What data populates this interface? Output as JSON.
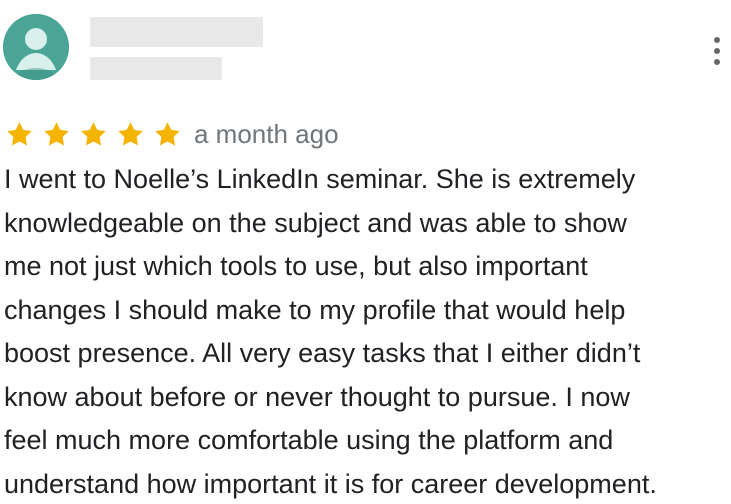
{
  "review": {
    "avatar_icon": "default-profile-avatar",
    "avatar_color": "#4aa597",
    "reviewer_name_redacted": true,
    "reviewer_meta_redacted": true,
    "more_icon": "more-vert-icon",
    "rating": 5,
    "max_rating": 5,
    "star_color": "#f4b400",
    "date": "a month ago",
    "text": "I went to Noelle’s LinkedIn seminar. She is extremely\nknowledgeable on the subject and was able to show\nme not just which tools to use, but also important\nchanges I should make to my profile that would help\nboost presence. All very easy tasks that I either didn’t\nknow about before or never thought to pursue. I now\nfeel much more comfortable using the platform and\nunderstand how important it is for career development."
  }
}
